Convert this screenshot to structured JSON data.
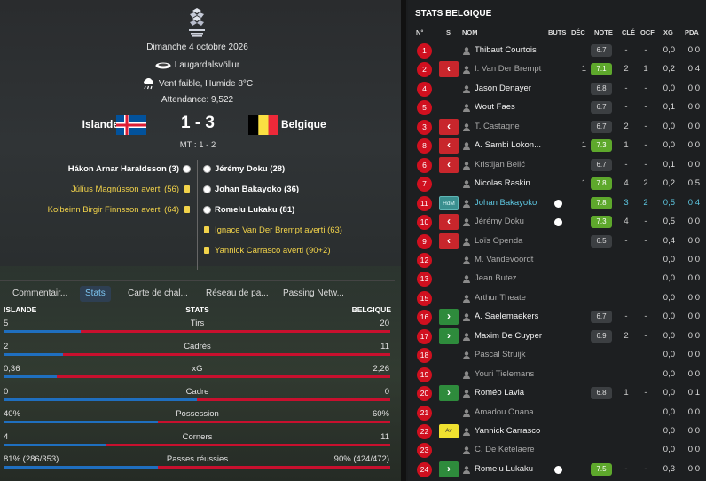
{
  "match": {
    "date": "Dimanche 4 octobre 2026",
    "stadium": "Laugardalsvöllur",
    "weather": "Vent faible, Humide 8°C",
    "attendance": "Attendance: 9,522",
    "home_team": "Islande",
    "away_team": "Belgique",
    "score": "1 - 3",
    "halftime": "MT : 1 - 2",
    "home_events": [
      {
        "text": "Hákon Arnar Haraldsson (3)",
        "type": "goal"
      },
      {
        "text": "Júlíus Magnússon averti (56)",
        "type": "yellow"
      },
      {
        "text": "Kolbeinn Birgir Finnsson averti (64)",
        "type": "yellow"
      }
    ],
    "away_events": [
      {
        "text": "Jérémy Doku (28)",
        "type": "goal"
      },
      {
        "text": "Johan Bakayoko (36)",
        "type": "goal"
      },
      {
        "text": "Romelu Lukaku (81)",
        "type": "goal"
      },
      {
        "text": "Ignace Van Der Brempt averti (63)",
        "type": "yellow"
      },
      {
        "text": "Yannick Carrasco averti (90+2)",
        "type": "yellow"
      }
    ]
  },
  "tabs": [
    "Commentair...",
    "Stats",
    "Carte de chal...",
    "Réseau de pa...",
    "Passing Netw..."
  ],
  "active_tab": "Stats",
  "stats": {
    "header_left": "ISLANDE",
    "header_center": "STATS",
    "header_right": "BELGIQUE",
    "rows": [
      {
        "label": "Tirs",
        "home": "5",
        "away": "20",
        "home_share": 0.2
      },
      {
        "label": "Cadrés",
        "home": "2",
        "away": "11",
        "home_share": 0.154
      },
      {
        "label": "xG",
        "home": "0,36",
        "away": "2,26",
        "home_share": 0.137
      },
      {
        "label": "Cadre",
        "home": "0",
        "away": "0",
        "home_share": 0.5
      },
      {
        "label": "Possession",
        "home": "40%",
        "away": "60%",
        "home_share": 0.4
      },
      {
        "label": "Corners",
        "home": "4",
        "away": "11",
        "home_share": 0.267
      },
      {
        "label": "Passes réussies",
        "home": "81% (286/353)",
        "away": "90% (424/472)",
        "home_share": 0.4
      }
    ]
  },
  "player_stats": {
    "title": "STATS BELGIQUE",
    "columns": [
      "N°",
      "S",
      "NOM",
      "BUTS",
      "DÉC",
      "NOTE",
      "CLÉ",
      "OCF",
      "XG",
      "PDA"
    ],
    "players": [
      {
        "num": "1",
        "sub": "",
        "name": "Thibaut Courtois",
        "dim": false,
        "ball": false,
        "buts": "",
        "dec": "",
        "note": "6.7",
        "note_color": "grey",
        "cle": "-",
        "ocf": "-",
        "xg": "0,0",
        "pda": "0,0"
      },
      {
        "num": "2",
        "sub": "out",
        "name": "I. Van Der Brempt",
        "dim": true,
        "ball": false,
        "buts": "",
        "dec": "1",
        "note": "7.1",
        "note_color": "green",
        "cle": "2",
        "ocf": "1",
        "xg": "0,2",
        "pda": "0,4"
      },
      {
        "num": "4",
        "sub": "",
        "name": "Jason Denayer",
        "dim": false,
        "ball": false,
        "buts": "",
        "dec": "",
        "note": "6.8",
        "note_color": "grey",
        "cle": "-",
        "ocf": "-",
        "xg": "0,0",
        "pda": "0,0"
      },
      {
        "num": "5",
        "sub": "",
        "name": "Wout Faes",
        "dim": false,
        "ball": false,
        "buts": "",
        "dec": "",
        "note": "6.7",
        "note_color": "grey",
        "cle": "-",
        "ocf": "-",
        "xg": "0,1",
        "pda": "0,0"
      },
      {
        "num": "3",
        "sub": "out",
        "name": "T. Castagne",
        "dim": true,
        "ball": false,
        "buts": "",
        "dec": "",
        "note": "6.7",
        "note_color": "grey",
        "cle": "2",
        "ocf": "-",
        "xg": "0,0",
        "pda": "0,0"
      },
      {
        "num": "8",
        "sub": "out",
        "name": "A. Sambi Lokon...",
        "dim": false,
        "ball": false,
        "buts": "",
        "dec": "1",
        "note": "7.3",
        "note_color": "green",
        "cle": "1",
        "ocf": "-",
        "xg": "0,0",
        "pda": "0,0"
      },
      {
        "num": "6",
        "sub": "out",
        "name": "Kristijan Belić",
        "dim": true,
        "ball": false,
        "buts": "",
        "dec": "",
        "note": "6.7",
        "note_color": "grey",
        "cle": "-",
        "ocf": "-",
        "xg": "0,1",
        "pda": "0,0"
      },
      {
        "num": "7",
        "sub": "",
        "name": "Nicolas Raskin",
        "dim": false,
        "ball": false,
        "buts": "",
        "dec": "1",
        "note": "7.8",
        "note_color": "green",
        "cle": "4",
        "ocf": "2",
        "xg": "0,2",
        "pda": "0,5"
      },
      {
        "num": "11",
        "sub": "hdm",
        "name": "Johan Bakayoko",
        "dim": false,
        "ball": true,
        "buts": "",
        "dec": "",
        "note": "7.8",
        "note_color": "green",
        "cle": "3",
        "ocf": "2",
        "xg": "0,5",
        "pda": "0,4",
        "highlight": true
      },
      {
        "num": "10",
        "sub": "out",
        "name": "Jérémy Doku",
        "dim": true,
        "ball": true,
        "buts": "",
        "dec": "",
        "note": "7.3",
        "note_color": "green",
        "cle": "4",
        "ocf": "-",
        "xg": "0,5",
        "pda": "0,0"
      },
      {
        "num": "9",
        "sub": "out",
        "name": "Loïs Openda",
        "dim": true,
        "ball": false,
        "buts": "",
        "dec": "",
        "note": "6.5",
        "note_color": "grey",
        "cle": "-",
        "ocf": "-",
        "xg": "0,4",
        "pda": "0,0"
      },
      {
        "num": "12",
        "sub": "",
        "name": "M. Vandevoordt",
        "dim": true,
        "ball": false,
        "buts": "",
        "dec": "",
        "note": "",
        "note_color": "",
        "cle": "",
        "ocf": "",
        "xg": "0,0",
        "pda": "0,0"
      },
      {
        "num": "13",
        "sub": "",
        "name": "Jean Butez",
        "dim": true,
        "ball": false,
        "buts": "",
        "dec": "",
        "note": "",
        "note_color": "",
        "cle": "",
        "ocf": "",
        "xg": "0,0",
        "pda": "0,0"
      },
      {
        "num": "15",
        "sub": "",
        "name": "Arthur Theate",
        "dim": true,
        "ball": false,
        "buts": "",
        "dec": "",
        "note": "",
        "note_color": "",
        "cle": "",
        "ocf": "",
        "xg": "0,0",
        "pda": "0,0"
      },
      {
        "num": "16",
        "sub": "in",
        "name": "A. Saelemaekers",
        "dim": false,
        "ball": false,
        "buts": "",
        "dec": "",
        "note": "6.7",
        "note_color": "grey",
        "cle": "-",
        "ocf": "-",
        "xg": "0,0",
        "pda": "0,0"
      },
      {
        "num": "17",
        "sub": "in",
        "name": "Maxim De Cuyper",
        "dim": false,
        "ball": false,
        "buts": "",
        "dec": "",
        "note": "6.9",
        "note_color": "grey",
        "cle": "2",
        "ocf": "-",
        "xg": "0,0",
        "pda": "0,0"
      },
      {
        "num": "18",
        "sub": "",
        "name": "Pascal Struijk",
        "dim": true,
        "ball": false,
        "buts": "",
        "dec": "",
        "note": "",
        "note_color": "",
        "cle": "",
        "ocf": "",
        "xg": "0,0",
        "pda": "0,0"
      },
      {
        "num": "19",
        "sub": "",
        "name": "Youri Tielemans",
        "dim": true,
        "ball": false,
        "buts": "",
        "dec": "",
        "note": "",
        "note_color": "",
        "cle": "",
        "ocf": "",
        "xg": "0,0",
        "pda": "0,0"
      },
      {
        "num": "20",
        "sub": "in",
        "name": "Roméo Lavia",
        "dim": false,
        "ball": false,
        "buts": "",
        "dec": "",
        "note": "6.8",
        "note_color": "grey",
        "cle": "1",
        "ocf": "-",
        "xg": "0,0",
        "pda": "0,1"
      },
      {
        "num": "21",
        "sub": "",
        "name": "Amadou Onana",
        "dim": true,
        "ball": false,
        "buts": "",
        "dec": "",
        "note": "",
        "note_color": "",
        "cle": "",
        "ocf": "",
        "xg": "0,0",
        "pda": "0,0"
      },
      {
        "num": "22",
        "sub": "av",
        "name": "Yannick Carrasco",
        "dim": false,
        "ball": false,
        "buts": "",
        "dec": "",
        "note": "",
        "note_color": "",
        "cle": "",
        "ocf": "",
        "xg": "0,0",
        "pda": "0,0"
      },
      {
        "num": "23",
        "sub": "",
        "name": "C. De Ketelaere",
        "dim": true,
        "ball": false,
        "buts": "",
        "dec": "",
        "note": "",
        "note_color": "",
        "cle": "",
        "ocf": "",
        "xg": "0,0",
        "pda": "0,0"
      },
      {
        "num": "24",
        "sub": "in",
        "name": "Romelu Lukaku",
        "dim": false,
        "ball": true,
        "buts": "",
        "dec": "",
        "note": "7.5",
        "note_color": "green",
        "cle": "-",
        "ocf": "-",
        "xg": "0,3",
        "pda": "0,0"
      }
    ],
    "badge_labels": {
      "hdm": "HdM",
      "av": "Av"
    }
  }
}
